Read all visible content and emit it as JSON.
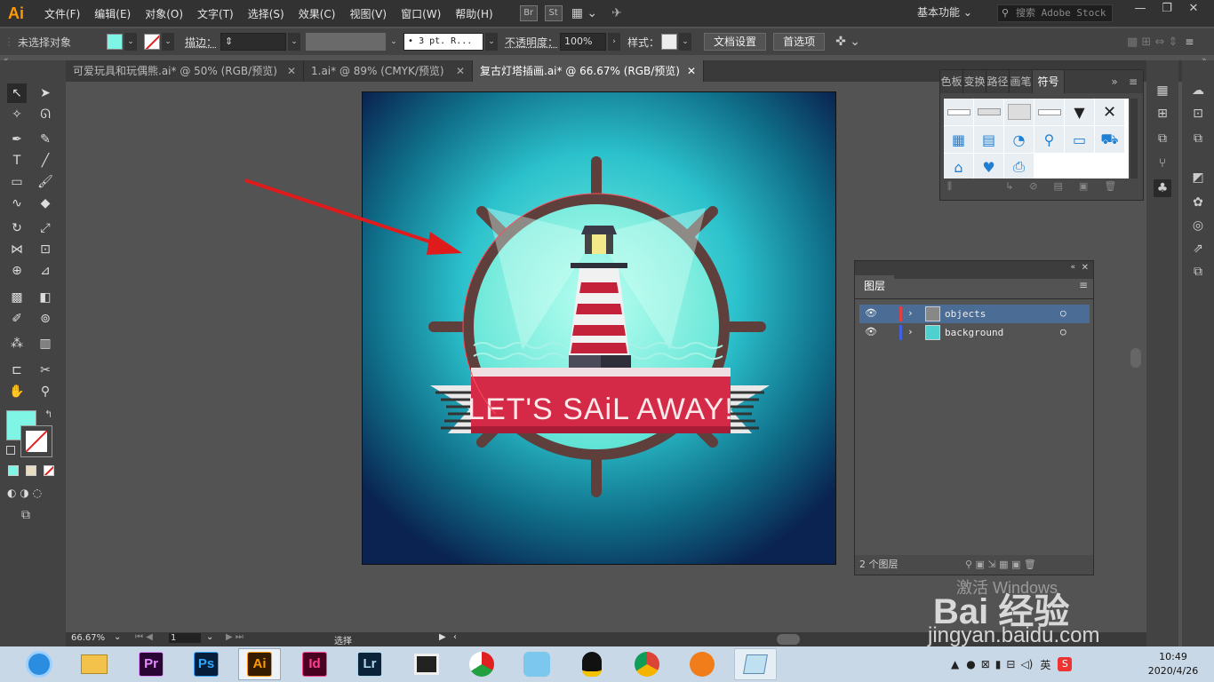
{
  "app": {
    "logo": "Ai",
    "workspace": "基本功能",
    "stock_placeholder": "搜索 Adobe Stock"
  },
  "menu": [
    "文件(F)",
    "编辑(E)",
    "对象(O)",
    "文字(T)",
    "选择(S)",
    "效果(C)",
    "视图(V)",
    "窗口(W)",
    "帮助(H)"
  ],
  "bridge": [
    "Br",
    "St"
  ],
  "control": {
    "selection": "未选择对象",
    "fill_color": "#7ff5e6",
    "stroke_label": "描边：",
    "brush": "3 pt. R...",
    "opacity_label": "不透明度：",
    "opacity": "100%",
    "style_label": "样式：",
    "doc_settings": "文档设置",
    "preferences": "首选项"
  },
  "tabs": [
    {
      "label": "可爱玩具和玩偶熊.ai* @ 50% (RGB/预览)",
      "active": false
    },
    {
      "label": "1.ai* @ 89% (CMYK/预览)",
      "active": false
    },
    {
      "label": "复古灯塔插画.ai* @ 66.67% (RGB/预览)",
      "active": true
    }
  ],
  "artwork": {
    "banner_text": "LET'S SAiL AWAY!"
  },
  "symbols_panel": {
    "tabs": [
      "色板",
      "变换",
      "路径",
      "画笔",
      "符号"
    ],
    "active_tab": "符号"
  },
  "layers_panel": {
    "title": "图层",
    "layers": [
      {
        "name": "objects",
        "color": "#e04040",
        "selected": true
      },
      {
        "name": "background",
        "color": "#4060e0",
        "selected": false
      }
    ],
    "footer": "2 个图层"
  },
  "status": {
    "zoom": "66.67%",
    "page": "1",
    "tool": "选择"
  },
  "watermark": {
    "line1": "激活 Windows",
    "brand": "Bai 经验",
    "url": "jingyan.baidu.com"
  },
  "taskbar": {
    "apps": [
      "Pr",
      "Ps",
      "Ai",
      "Id",
      "Lr"
    ],
    "ime": "英",
    "time": "10:49",
    "date": "2020/4/26"
  }
}
